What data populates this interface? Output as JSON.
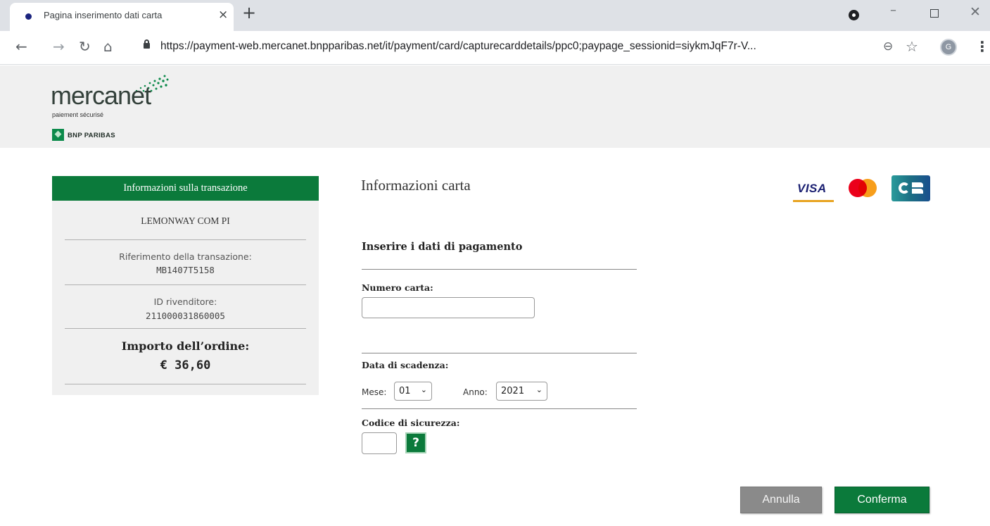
{
  "browser": {
    "tab_title": "Pagina inserimento dati carta",
    "tab_close": "×",
    "new_tab": "+",
    "url": "https://payment-web.mercanet.bnpparibas.net/it/payment/card/capturecarddetails/ppc0;paypage_sessionid=siykmJqF7r-V...",
    "profile_initial": "G",
    "icons": [
      "back-icon",
      "forward-icon",
      "reload-icon",
      "home-icon",
      "lock-icon",
      "zoom-icon",
      "star-icon",
      "menu-icon"
    ]
  },
  "header": {
    "logo_word": "mercanet",
    "logo_tagline": "paiement sécurisé",
    "bank_name": "BNP PARIBAS"
  },
  "transaction": {
    "title": "Informazioni sulla transazione",
    "merchant": "LEMONWAY COM PI",
    "reference_label": "Riferimento della transazione:",
    "reference_value": "MB1407T5158",
    "reseller_label": "ID rivenditore:",
    "reseller_value": "211000031860005",
    "amount_label": "Importo dell’ordine:",
    "amount_value": "€ 36,60"
  },
  "form": {
    "section_title": "Informazioni carta",
    "subtitle": "Inserire i dati di pagamento",
    "card_number_label": "Numero carta:",
    "card_number_value": "",
    "expiry_label": "Data di scadenza:",
    "month_label": "Mese:",
    "month_value": "01",
    "year_label": "Anno:",
    "year_value": "2021",
    "cvv_label": "Codice di sicurezza:",
    "cvv_value": "",
    "help_label": "?",
    "card_brands": [
      "VISA",
      "Mastercard",
      "CB"
    ],
    "visa_text": "VISA"
  },
  "actions": {
    "cancel_label": "Annulla",
    "confirm_label": "Conferma"
  },
  "colors": {
    "brand_green": "#0b7a3b",
    "panel_bg": "#f0f0f0",
    "cancel_gray": "#8a8a8a"
  }
}
